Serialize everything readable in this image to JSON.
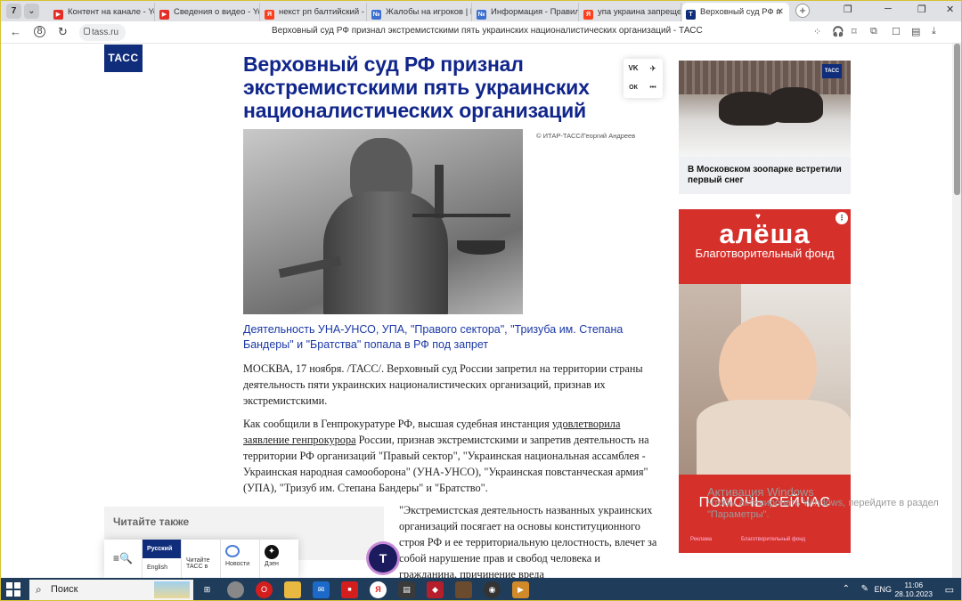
{
  "browser": {
    "tab_count": "7",
    "tabs": [
      {
        "title": "Контент на канале - You",
        "icon": "youtube",
        "color": "#e52d27"
      },
      {
        "title": "Сведения о видео - You",
        "icon": "youtube",
        "color": "#e52d27"
      },
      {
        "title": "некст рп балтийский -",
        "icon": "yandex",
        "color": "#fc3f1d"
      },
      {
        "title": "Жалобы на игроков | N",
        "icon": "forum",
        "color": "#3b6fd1"
      },
      {
        "title": "Информация - Правил",
        "icon": "forum",
        "color": "#3b6fd1"
      },
      {
        "title": "упа украина запрещен",
        "icon": "yandex",
        "color": "#fc3f1d"
      },
      {
        "title": "Верховный суд РФ п",
        "icon": "tass",
        "color": "#0f2d7a",
        "active": true
      }
    ],
    "url": "tass.ru",
    "page_title": "Верховный суд РФ признал экстремистскими пять украинских националистических организаций - ТАСС"
  },
  "article": {
    "logo": "ТАСС",
    "headline": "Верховный суд РФ признал экстремистскими пять украинских националистических организаций",
    "photo_credit": "© ИТАР-ТАСС/Георгий Андреев",
    "lead": "Деятельность УНА-УНСО, УПА, \"Правого сектора\", \"Тризуба им. Степана Бандеры\" и \"Братства\" попала в РФ под запрет",
    "p1": "МОСКВА, 17 ноября. /ТАСС/. Верховный суд России запретил на территории страны деятельность пяти украинских националистических организаций, признав их экстремистскими.",
    "p2_a": "Как сообщили в Генпрокуратуре РФ, высшая судебная инстанция ",
    "p2_link": "удовлетворила заявление генпрокурора",
    "p2_b": " России, признав экстремистскими и запретив деятельность на территории РФ организаций \"Правый сектор\", \"Украинская национальная ассамблея - Украинская народная самооборона\" (УНА-УНСО), \"Украинская повстанческая армия\" (УПА), \"Тризуб им. Степана Бандеры\" и \"Братство\".",
    "quote": "\"Экстремистская деятельность названных украинских организаций посягает на основы конституционного строя РФ и ее территориальную целостность, влечет за собой нарушение прав и свобод человека и гражданина, причинение вреда",
    "read_also": "Читайте также",
    "telegram_bubble": "T"
  },
  "langbar": {
    "lang_ru": "Русский",
    "lang_en": "English",
    "read_tass": "Читайте ТАСС в",
    "news": "Новости",
    "dzen": "Дзен"
  },
  "share": {
    "vk": "VK",
    "tg": "✈",
    "ok": "ОК",
    "more": "•••"
  },
  "sidebar": {
    "news_tag": "ТАСС",
    "news_title": "В Московском зоопарке встретили первый снег",
    "ad_logo": "алёша",
    "ad_sub": "Благотворительный фонд",
    "ad_cta": "ПОМОЧЬ СЕЙЧАС",
    "ad_small": "Реклама",
    "ad_small2": "Благотворительный фонд"
  },
  "watermark": {
    "title": "Активация Windows",
    "text": "Чтобы активировать Windows, перейдите в раздел \"Параметры\"."
  },
  "taskbar": {
    "search": "Поиск",
    "lang": "ENG",
    "time": "11:06",
    "date": "28.10.2023"
  }
}
